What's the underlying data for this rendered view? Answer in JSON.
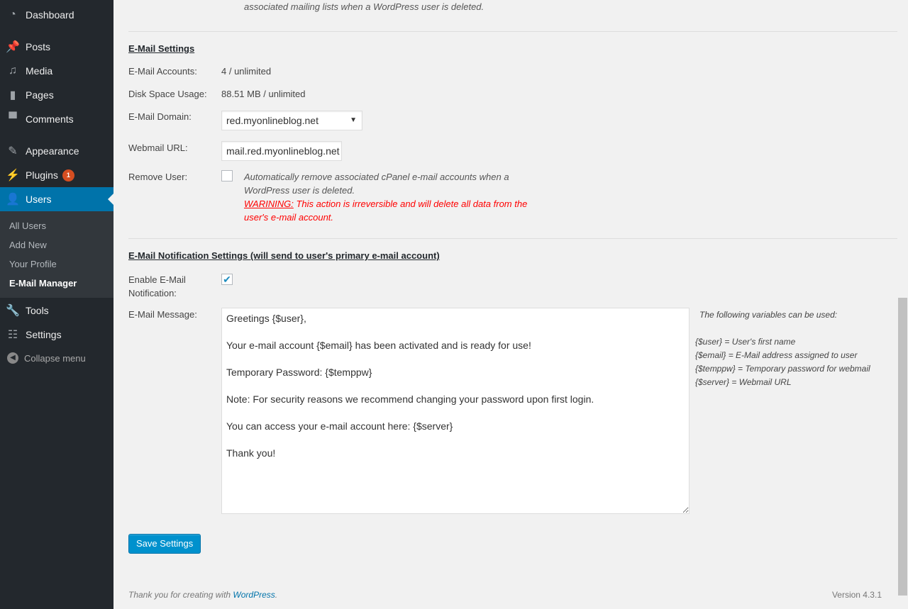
{
  "sidebar": {
    "items": [
      {
        "label": "Dashboard",
        "icon": "dashboard-icon"
      },
      {
        "label": "Posts",
        "icon": "pin-icon"
      },
      {
        "label": "Media",
        "icon": "media-icon"
      },
      {
        "label": "Pages",
        "icon": "pages-icon"
      },
      {
        "label": "Comments",
        "icon": "comment-icon"
      },
      {
        "label": "Appearance",
        "icon": "paintbrush-icon"
      },
      {
        "label": "Plugins",
        "icon": "plugin-icon",
        "badge": "1"
      },
      {
        "label": "Users",
        "icon": "user-icon"
      },
      {
        "label": "Tools",
        "icon": "wrench-icon"
      },
      {
        "label": "Settings",
        "icon": "settings-icon"
      }
    ],
    "submenu": [
      "All Users",
      "Add New",
      "Your Profile",
      "E-Mail Manager"
    ],
    "collapse": "Collapse menu"
  },
  "top_desc": "associated mailing lists when a WordPress user is deleted.",
  "email_settings": {
    "heading": "E-Mail Settings",
    "accounts_label": "E-Mail Accounts:",
    "accounts_value": "4 / unlimited",
    "disk_label": "Disk Space Usage:",
    "disk_value": "88.51 MB / unlimited",
    "domain_label": "E-Mail Domain:",
    "domain_value": "red.myonlineblog.net",
    "webmail_label": "Webmail URL:",
    "webmail_value": "mail.red.myonlineblog.net",
    "remove_label": "Remove User:",
    "remove_checked": false,
    "remove_desc": "Automatically remove associated cPanel e-mail accounts when a WordPress user is deleted.",
    "warning_label": "WARINING:",
    "warning_text": " This action is irreversible and will delete all data from the user's e-mail account."
  },
  "notification": {
    "heading": "E-Mail Notification Settings (will send to user's primary e-mail account)",
    "enable_label": "Enable E-Mail Notification:",
    "enable_checked": true,
    "message_label": "E-Mail Message:",
    "message": "Greetings {$user},\n\nYour e-mail account {$email} has been activated and is ready for use!\n\nTemporary Password: {$temppw}\n\nNote: For security reasons we recommend changing your password upon first login.\n\nYou can access your e-mail account here: {$server}\n\nThank you!",
    "vars_title": "The following variables can be used:",
    "vars": [
      "{$user} = User's first name",
      "{$email} = E-Mail address assigned to user",
      "{$temppw} = Temporary password for webmail",
      "{$server} = Webmail URL"
    ]
  },
  "save_label": "Save Settings",
  "footer": {
    "thanks": "Thank you for creating with ",
    "link": "WordPress",
    "period": ".",
    "version": "Version 4.3.1"
  },
  "colors": {
    "accent": "#0073aa",
    "warning": "#ff0000",
    "sidebar": "#23282d"
  }
}
